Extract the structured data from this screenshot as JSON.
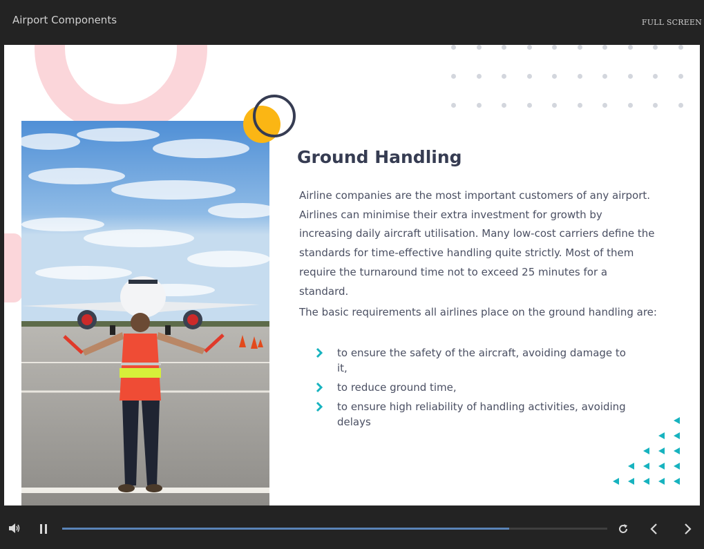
{
  "header": {
    "course_title": "Airport Components",
    "fullscreen_label": "FULL SCREEN"
  },
  "slide": {
    "heading": "Ground Handling",
    "paragraph1": "Airline companies are the most important customers of any airport. Airlines can minimise their extra investment for growth by increasing daily aircraft utilisation. Many low-cost carriers define the standards for time-effective handling quite strictly. Most of them require the turnaround time not to exceed 25 minutes for a standard.",
    "paragraph2": "The basic requirements all airlines place on the ground handling are:",
    "bullets": [
      "to ensure the safety of the aircraft, avoiding damage to it,",
      "to reduce ground time,",
      "to ensure high reliability of handling activities, avoiding delays"
    ],
    "image_icon": "airport-marshaller-photo"
  },
  "player": {
    "progress_fraction": 0.82,
    "icons": [
      "volume-icon",
      "pause-icon",
      "replay-icon",
      "prev-icon",
      "next-icon"
    ]
  },
  "colors": {
    "accent_teal": "#17b3bf",
    "accent_yellow": "#fbb614",
    "heading_navy": "#363c52",
    "deco_pink": "#fbd6da",
    "progress_blue": "#5a84b8"
  }
}
